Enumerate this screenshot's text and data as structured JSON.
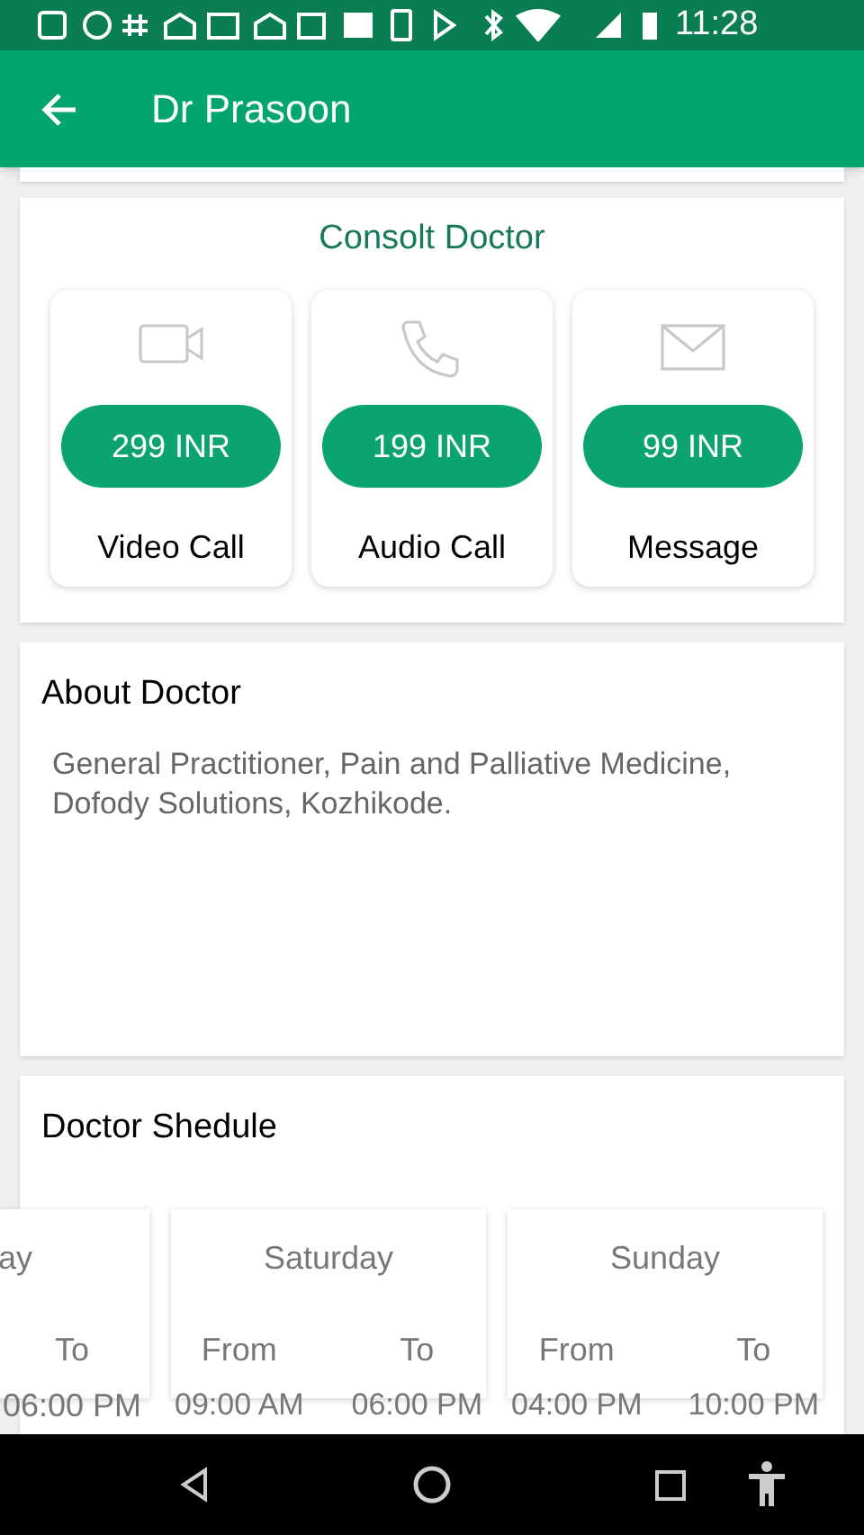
{
  "status_bar": {
    "time": "11:28"
  },
  "app_bar": {
    "title": "Dr Prasoon"
  },
  "consult": {
    "title": "Consolt Doctor",
    "options": [
      {
        "kind": "video",
        "price": "299 INR",
        "label": "Video Call"
      },
      {
        "kind": "audio",
        "price": "199 INR",
        "label": "Audio Call"
      },
      {
        "kind": "message",
        "price": "99 INR",
        "label": "Message"
      }
    ]
  },
  "about": {
    "title": "About Doctor",
    "text": "General Practitioner, Pain and Palliative Medicine, Dofody Solutions, Kozhikode."
  },
  "schedule": {
    "title": "Doctor Shedule",
    "days": [
      {
        "kind": "partial",
        "day": "ay",
        "to_label": "To",
        "to": "06:00 PM"
      },
      {
        "kind": "full",
        "day": "Saturday",
        "from_label": "From",
        "from": "09:00 AM",
        "to_label": "To",
        "to": "06:00 PM"
      },
      {
        "kind": "full",
        "day": "Sunday",
        "from_label": "From",
        "from": "04:00 PM",
        "to_label": "To",
        "to": "10:00 PM"
      }
    ]
  }
}
